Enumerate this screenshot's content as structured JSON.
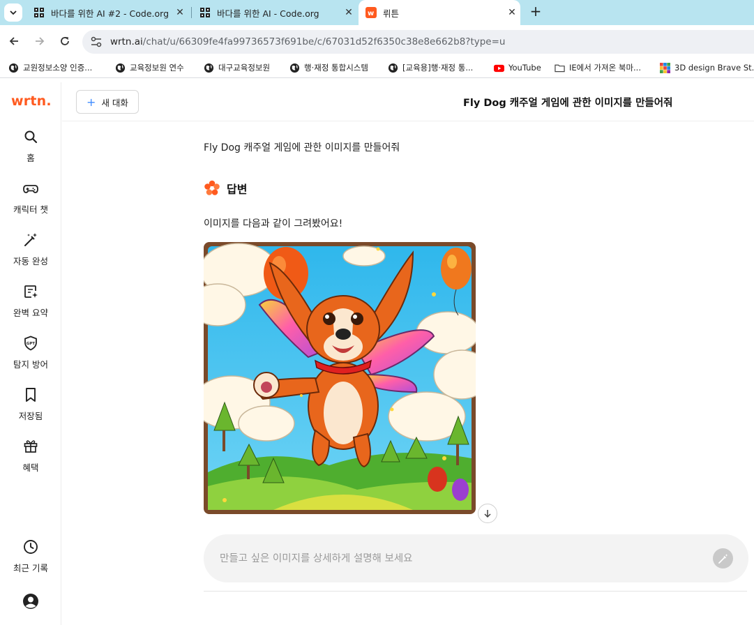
{
  "browser": {
    "tabs": [
      {
        "title": "바다를 위한 AI #2 - Code.org",
        "favicon": "code-org-icon"
      },
      {
        "title": "바다를 위한 AI - Code.org",
        "favicon": "code-org-icon"
      },
      {
        "title": "뤼튼",
        "favicon": "wrtn-icon",
        "active": true
      }
    ],
    "url_host": "wrtn.ai",
    "url_path": "/chat/u/66309fe4fa99736573f691be/c/67031d52f6350c38e8e662b8?type=u",
    "bookmarks": [
      {
        "label": "교원정보소양 인증...",
        "icon": "globe-icon"
      },
      {
        "label": "교육정보원 연수",
        "icon": "globe-icon"
      },
      {
        "label": "대구교육정보원",
        "icon": "globe-icon"
      },
      {
        "label": "행·재정 통합시스템",
        "icon": "globe-icon"
      },
      {
        "label": "[교육용]행·재정 통...",
        "icon": "globe-icon"
      },
      {
        "label": "YouTube",
        "icon": "youtube-icon"
      },
      {
        "label": "IE에서 가져온 북마...",
        "icon": "folder-icon"
      },
      {
        "label": "3D design Brave St...",
        "icon": "tinkercad-icon"
      }
    ]
  },
  "app": {
    "logo": "wrtn.",
    "brand_color": "#ff5a1f",
    "nav": [
      {
        "label": "홈",
        "icon": "search-icon"
      },
      {
        "label": "캐릭터 챗",
        "icon": "gamepad-icon"
      },
      {
        "label": "자동 완성",
        "icon": "magic-wand-icon"
      },
      {
        "label": "완벽 요약",
        "icon": "document-sparkle-icon"
      },
      {
        "label": "탐지 방어",
        "icon": "gpt-shield-icon"
      },
      {
        "label": "저장됨",
        "icon": "bookmark-icon"
      },
      {
        "label": "혜택",
        "icon": "gift-icon"
      }
    ],
    "recent_label": "최근 기록",
    "new_chat_label": "새 대화",
    "chat_title": "Fly Dog 캐주얼 게임에 관한 이미지를 만들어줘"
  },
  "conversation": {
    "user_message": "Fly Dog 캐주얼 게임에 관한 이미지를 만들어줘",
    "answer_label": "답변",
    "reply_text": "이미지를 다음과 같이 그려봤어요!",
    "image_subject": "flying-dog-illustration"
  },
  "composer": {
    "placeholder": "만들고 싶은 이미지를 상세하게 설명해 보세요"
  }
}
